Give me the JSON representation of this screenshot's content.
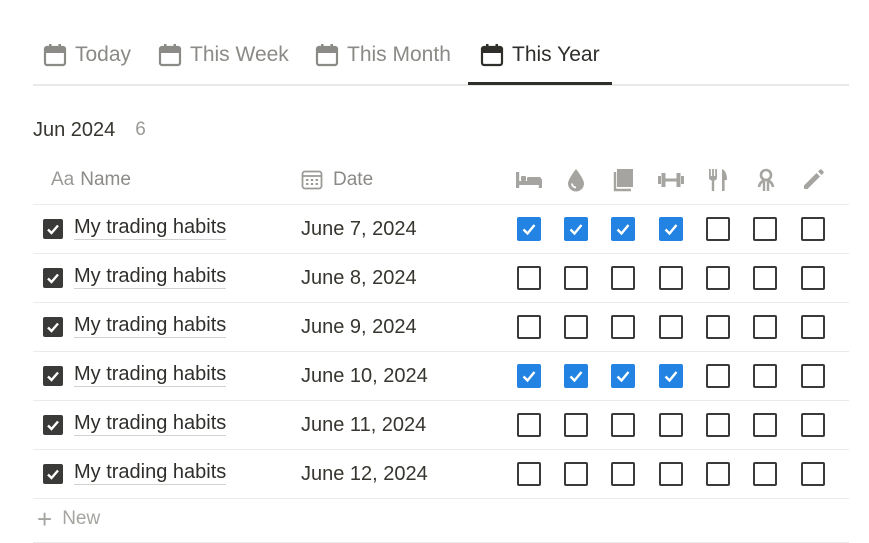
{
  "tabs": [
    {
      "label": "Today",
      "icon": "calendar-icon",
      "active": false
    },
    {
      "label": "This Week",
      "icon": "calendar-icon",
      "active": false
    },
    {
      "label": "This Month",
      "icon": "calendar-icon",
      "active": false
    },
    {
      "label": "This Year",
      "icon": "calendar-icon",
      "active": true
    }
  ],
  "group": {
    "title": "Jun 2024",
    "count": "6"
  },
  "columns": {
    "name_label": "Name",
    "name_icon": "text-property-icon",
    "date_label": "Date",
    "date_icon": "calendar-property-icon",
    "habit_icons": [
      "bed-icon",
      "water-drop-icon",
      "book-icon",
      "dumbbell-icon",
      "fork-knife-icon",
      "meditation-icon",
      "pencil-icon"
    ]
  },
  "rows": [
    {
      "name": "My trading habits",
      "date": "June 7, 2024",
      "checks": [
        true,
        true,
        true,
        true,
        false,
        false,
        false
      ]
    },
    {
      "name": "My trading habits",
      "date": "June 8, 2024",
      "checks": [
        false,
        false,
        false,
        false,
        false,
        false,
        false
      ]
    },
    {
      "name": "My trading habits",
      "date": "June 9, 2024",
      "checks": [
        false,
        false,
        false,
        false,
        false,
        false,
        false
      ]
    },
    {
      "name": "My trading habits",
      "date": "June 10, 2024",
      "checks": [
        true,
        true,
        true,
        true,
        false,
        false,
        false
      ]
    },
    {
      "name": "My trading habits",
      "date": "June 11, 2024",
      "checks": [
        false,
        false,
        false,
        false,
        false,
        false,
        false
      ]
    },
    {
      "name": "My trading habits",
      "date": "June 12, 2024",
      "checks": [
        false,
        false,
        false,
        false,
        false,
        false,
        false
      ]
    }
  ],
  "new_row": {
    "label": "New"
  },
  "colors": {
    "accent": "#2383e2",
    "text": "#37352f",
    "muted": "#8b8a86"
  }
}
